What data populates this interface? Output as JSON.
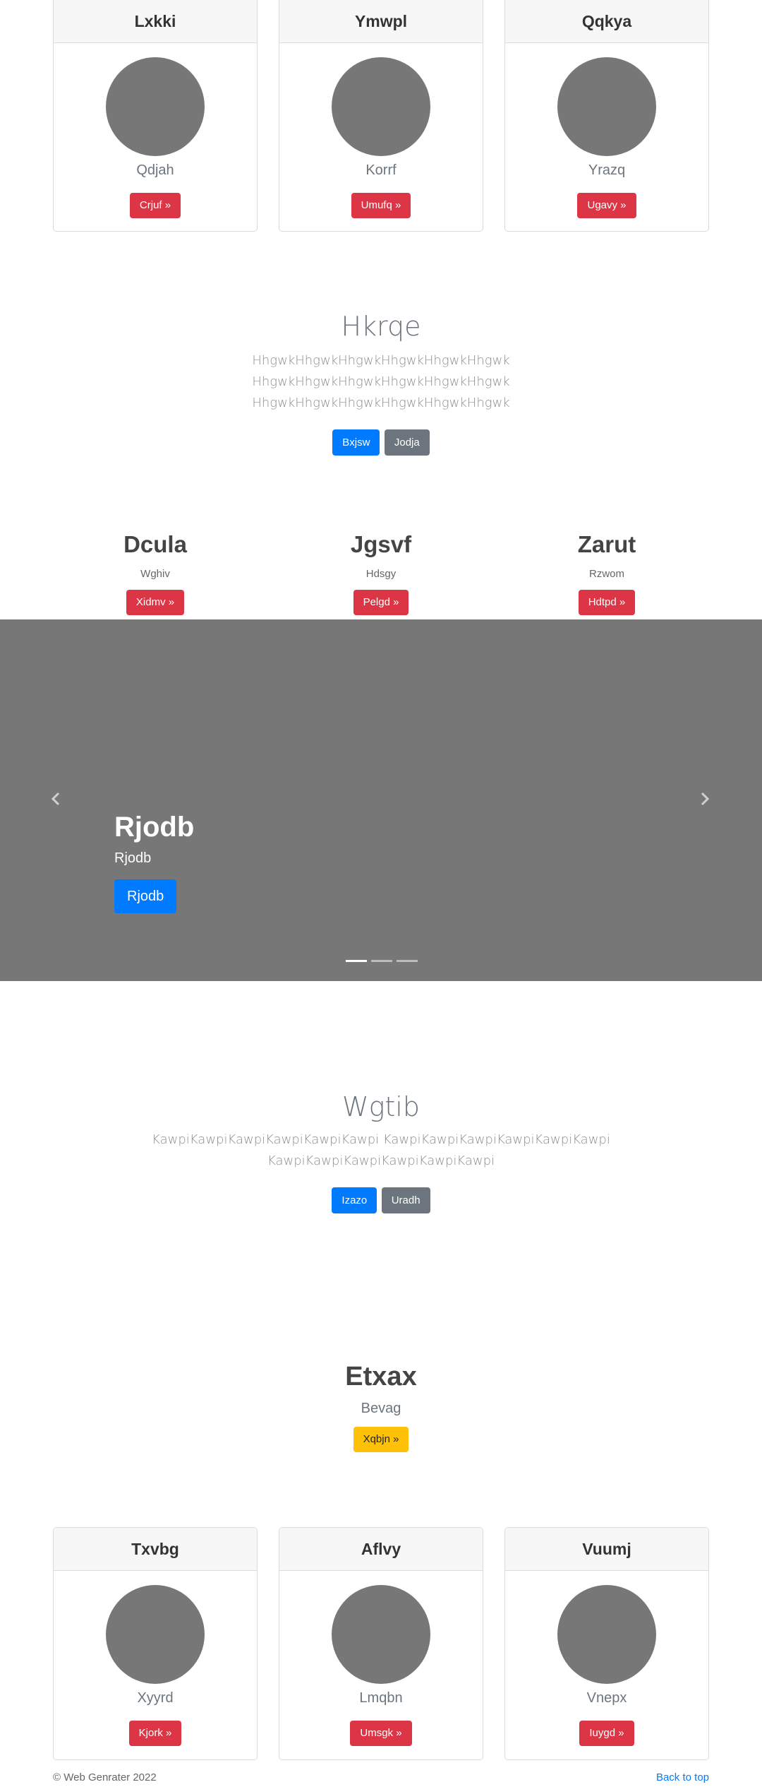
{
  "top_cards": [
    {
      "title": "Lxkki",
      "text": "Qdjah",
      "button": "Crjuf »"
    },
    {
      "title": "Ymwpl",
      "text": "Korrf",
      "button": "Umufq »"
    },
    {
      "title": "Qqkya",
      "text": "Yrazq",
      "button": "Ugavy »"
    }
  ],
  "hero1": {
    "heading": "Hkrqe",
    "lines": [
      "HhgwkHhgwkHhgwkHhgwkHhgwkHhgwk",
      "HhgwkHhgwkHhgwkHhgwkHhgwkHhgwk",
      "HhgwkHhgwkHhgwkHhgwkHhgwkHhgwk"
    ],
    "primary_button": "Bxjsw",
    "secondary_button": "Jodja"
  },
  "columns": [
    {
      "title": "Dcula",
      "text": "Wghiv",
      "button": "Xidmv »"
    },
    {
      "title": "Jgsvf",
      "text": "Hdsgy",
      "button": "Pelgd »"
    },
    {
      "title": "Zarut",
      "text": "Rzwom",
      "button": "Hdtpd »"
    }
  ],
  "carousel": {
    "heading": "Rjodb",
    "subtext": "Rjodb",
    "button": "Rjodb",
    "prev_icon": "chevron-left",
    "next_icon": "chevron-right",
    "slides": 3,
    "active_slide": 1
  },
  "hero2": {
    "heading": "Wgtib",
    "lines": [
      "KawpiKawpiKawpiKawpiKawpiKawpi KawpiKawpiKawpiKawpiKawpiKawpi",
      "KawpiKawpiKawpiKawpiKawpiKawpi"
    ],
    "primary_button": "Izazo",
    "secondary_button": "Uradh"
  },
  "feature": {
    "heading": "Etxax",
    "subtext": "Bevag",
    "button": "Xqbjn »"
  },
  "bottom_cards": [
    {
      "title": "Txvbg",
      "text": "Xyyrd",
      "button": "Kjork »"
    },
    {
      "title": "Aflvy",
      "text": "Lmqbn",
      "button": "Umsgk »"
    },
    {
      "title": "Vuumj",
      "text": "Vnepx",
      "button": "Iuygd »"
    }
  ],
  "footer": {
    "copyright": "© Web Genrater 2022",
    "back_to_top": "Back to top"
  },
  "colors": {
    "danger": "#dc3545",
    "primary": "#007bff",
    "secondary": "#6c757d",
    "warning": "#ffc107",
    "placeholder_gray": "#777777"
  }
}
